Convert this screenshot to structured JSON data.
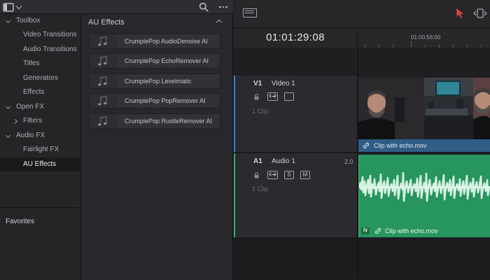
{
  "colors": {
    "accent": "#d8443a",
    "video_track_bar": "#2f5d86",
    "video_track_marker": "#3b7fc8",
    "audio_clip": "#27955e",
    "audio_track_marker": "#2fb36c",
    "selected_row_bg": "#1a1a1c"
  },
  "library": {
    "tree": [
      {
        "label": "Toolbox",
        "level": 0,
        "expanded": true,
        "selected": false
      },
      {
        "label": "Video Transitions",
        "level": 1,
        "selected": false
      },
      {
        "label": "Audio Transitions",
        "level": 1,
        "selected": false
      },
      {
        "label": "Titles",
        "level": 1,
        "selected": false
      },
      {
        "label": "Generators",
        "level": 1,
        "selected": false
      },
      {
        "label": "Effects",
        "level": 1,
        "selected": false
      },
      {
        "label": "Open FX",
        "level": 0,
        "expanded": true,
        "selected": false
      },
      {
        "label": "Filters",
        "level": 1,
        "expanded": false,
        "selected": false
      },
      {
        "label": "Audio FX",
        "level": 0,
        "expanded": true,
        "selected": false
      },
      {
        "label": "Fairlight FX",
        "level": 1,
        "selected": false
      },
      {
        "label": "AU Effects",
        "level": 1,
        "selected": true
      }
    ],
    "favorites_label": "Favorites",
    "effects_title": "AU Effects",
    "effects": [
      "CrumplePop AudioDenoise AI",
      "CrumplePop EchoRemover AI",
      "CrumplePop Levelmatic",
      "CrumplePop PopRemover AI",
      "CrumplePop RustleRemover AI"
    ],
    "icons": [
      "panel-toggle-icon",
      "chevron-down-icon",
      "search-icon",
      "more-options-icon",
      "music-note-icon"
    ]
  },
  "timeline": {
    "timecode": "01:01:29:08",
    "ruler_time": "01:00:56:00",
    "tracks": [
      {
        "id": "V1",
        "name": "Video 1",
        "clip_count": "1 Clip",
        "clip_name": "Clip with echo.mov"
      },
      {
        "id": "A1",
        "name": "Audio 1",
        "channel_format": "2.0",
        "clip_count": "1 Clip",
        "clip_name": "Clip with echo.mov",
        "solo_label": "S",
        "mute_label": "M",
        "fx_badge": "fx"
      }
    ],
    "icons": [
      "timeline-layout-icon",
      "selection-cursor-icon",
      "trim-mode-icon",
      "lock-icon",
      "auto-select-icon",
      "monitor-icon",
      "link-icon"
    ]
  }
}
